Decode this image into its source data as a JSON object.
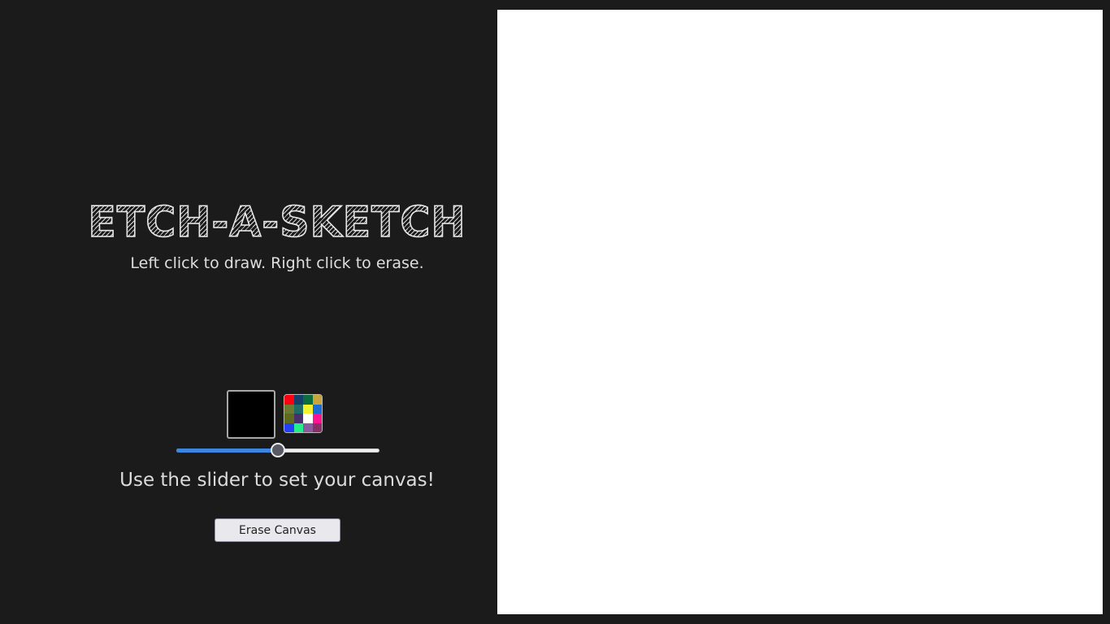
{
  "header": {
    "title": "ETCH-A-SKETCH",
    "subtitle": "Left click to draw. Right click to erase."
  },
  "controls": {
    "current_color": "#000000",
    "palette_colors": [
      "#ff0010",
      "#163f6b",
      "#0c6e3f",
      "#c9a53a",
      "#6d7a2f",
      "#1f6e66",
      "#f2f230",
      "#1b6dd6",
      "#5e6b1e",
      "#4a2f6e",
      "#ffffff",
      "#ff1493",
      "#2340f5",
      "#23f08a",
      "#8a5c9e",
      "#8a2e66"
    ],
    "slider": {
      "min": 0,
      "max": 100,
      "value": 50,
      "track_color": "#efefef",
      "fill_color": "#3d86e0"
    },
    "hint": "Use the slider to set your canvas!",
    "erase_label": "Erase Canvas"
  },
  "canvas": {
    "background": "#ffffff"
  }
}
